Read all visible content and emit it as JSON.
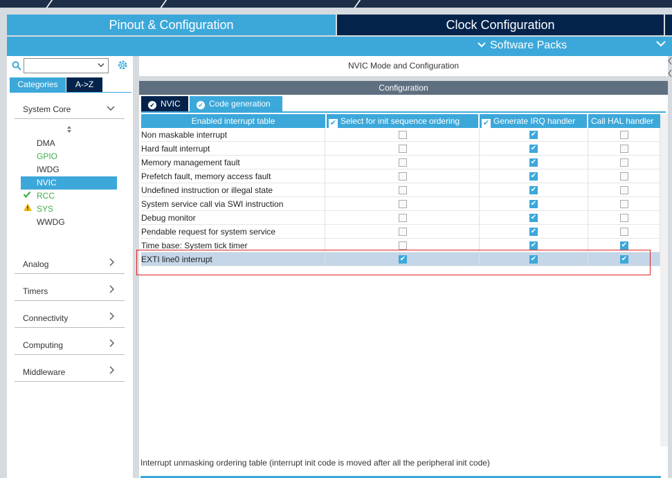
{
  "top_tabs": {
    "pinout": "Pinout & Configuration",
    "clock": "Clock Configuration"
  },
  "software_packs": "Software Packs",
  "search": {
    "value": ""
  },
  "category_tabs": {
    "categories": "Categories",
    "az": "A->Z"
  },
  "sidebar": {
    "system_core": {
      "label": "System Core",
      "items": [
        {
          "label": "DMA",
          "state": "normal"
        },
        {
          "label": "GPIO",
          "state": "green"
        },
        {
          "label": "IWDG",
          "state": "normal"
        },
        {
          "label": "NVIC",
          "state": "selected"
        },
        {
          "label": "RCC",
          "state": "check"
        },
        {
          "label": "SYS",
          "state": "warning"
        },
        {
          "label": "WWDG",
          "state": "normal"
        }
      ]
    },
    "groups": [
      {
        "label": "Analog"
      },
      {
        "label": "Timers"
      },
      {
        "label": "Connectivity"
      },
      {
        "label": "Computing"
      },
      {
        "label": "Middleware"
      }
    ]
  },
  "main": {
    "mode_title": "NVIC Mode and Configuration",
    "config_title": "Configuration",
    "subtabs": {
      "nvic": "NVIC",
      "code_generation": "Code generation"
    },
    "table": {
      "headers": [
        "Enabled interrupt table",
        "Select for init sequence ordering",
        "Generate IRQ handler",
        "Call HAL handler"
      ],
      "rows": [
        {
          "name": "Non maskable interrupt",
          "init": false,
          "irq": true,
          "hal": false
        },
        {
          "name": "Hard fault interrupt",
          "init": false,
          "irq": true,
          "hal": false
        },
        {
          "name": "Memory management fault",
          "init": false,
          "irq": true,
          "hal": false
        },
        {
          "name": "Prefetch fault, memory access fault",
          "init": false,
          "irq": true,
          "hal": false
        },
        {
          "name": "Undefined instruction or illegal state",
          "init": false,
          "irq": true,
          "hal": false
        },
        {
          "name": "System service call via SWI instruction",
          "init": false,
          "irq": true,
          "hal": false
        },
        {
          "name": "Debug monitor",
          "init": false,
          "irq": true,
          "hal": false
        },
        {
          "name": "Pendable request for system service",
          "init": false,
          "irq": true,
          "hal": false
        },
        {
          "name": "Time base: System tick timer",
          "init": false,
          "irq": true,
          "hal": true
        },
        {
          "name": "EXTI line0 interrupt",
          "init": true,
          "irq": true,
          "hal": true
        }
      ]
    },
    "footer_note": "Interrupt unmasking ordering table (interrupt init code is moved after all the peripheral init code)"
  },
  "colors": {
    "accent": "#3ca8da",
    "navy": "#03234b",
    "highlight_row": "#c4d6e8",
    "annotation_box": "#e02020"
  }
}
